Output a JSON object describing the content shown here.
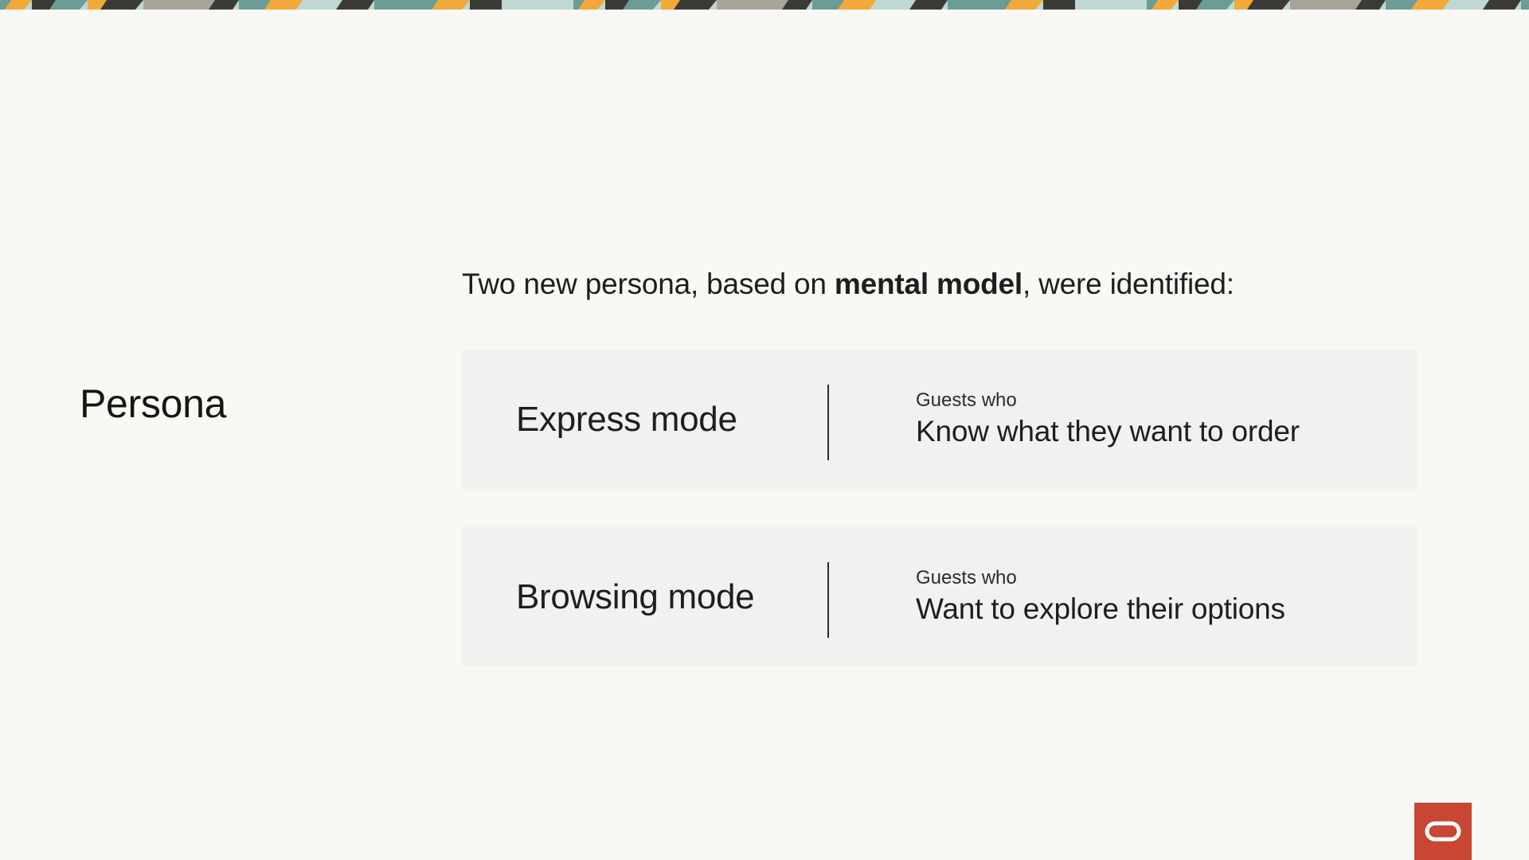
{
  "slide": {
    "title": "Persona",
    "intro_before": "Two new persona, based on ",
    "intro_bold": "mental model",
    "intro_after": ", were identified:",
    "modes": [
      {
        "name": "Express mode",
        "sub_label": "Guests who",
        "description": "Know what they want to order"
      },
      {
        "name": "Browsing mode",
        "sub_label": "Guests who",
        "description": "Want to explore their options"
      }
    ]
  },
  "decor": {
    "band_icon": "patterned-border",
    "logo_icon": "oracle-logo-icon",
    "colors": {
      "logo": "#c74634",
      "card": "#f1f1f0",
      "background": "#f9f8f5",
      "band_teal": "#6b9c95",
      "band_yellow": "#f1a93a",
      "band_dark": "#3b3b36",
      "band_light": "#bfd8d3",
      "band_gray": "#a8a49c"
    }
  }
}
